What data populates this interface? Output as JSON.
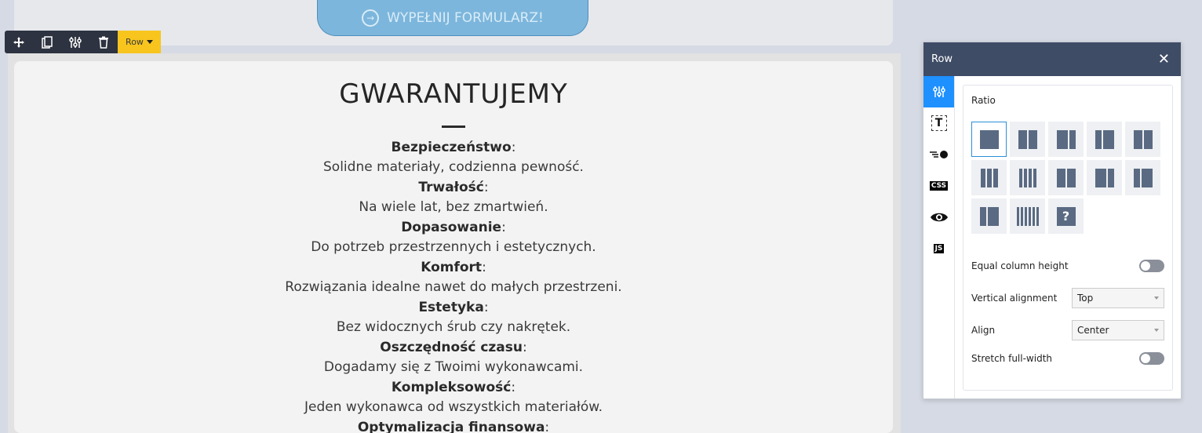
{
  "cta": {
    "label": "WYPEŁNIJ FORMULARZ!",
    "icon": "arrow-circle-right-icon"
  },
  "row_toolbar": {
    "icons": [
      "move-icon",
      "copy-icon",
      "settings-icon",
      "trash-icon"
    ],
    "label": "Row"
  },
  "section": {
    "heading": "GWARANTUJEMY",
    "items": [
      {
        "title": "Bezpieczeństwo",
        "suffix": ":",
        "desc": "Solidne materiały, codzienna pewność."
      },
      {
        "title": "Trwałość",
        "suffix": ":",
        "desc": "Na wiele lat, bez zmartwień."
      },
      {
        "title": "Dopasowanie",
        "suffix": ":",
        "desc": "Do potrzeb przestrzennych i estetycznych."
      },
      {
        "title": "Komfort",
        "suffix": ":",
        "desc": "Rozwiązania idealne nawet do małych przestrzeni."
      },
      {
        "title": "Estetyka",
        "suffix": ":",
        "desc": "Bez widocznych śrub czy nakrętek."
      },
      {
        "title": "Oszczędność czasu",
        "suffix": ":",
        "desc": "Dogadamy się z Twoimi wykonawcami."
      },
      {
        "title": "Kompleksowość",
        "suffix": ":",
        "desc": "Jeden wykonawca od wszystkich materiałów."
      },
      {
        "title": "Optymalizacja finansowa",
        "suffix": ":",
        "desc": ""
      }
    ]
  },
  "panel": {
    "title": "Row",
    "close": "✕",
    "tabs": [
      "sliders-icon",
      "text-icon",
      "animation-icon",
      "css-icon",
      "eye-icon",
      "js-icon"
    ],
    "tab_labels": {
      "css": "CSS",
      "js": "JS",
      "text": "T"
    },
    "ratio_title": "Ratio",
    "settings": {
      "equal_height": "Equal column height",
      "vertical_alignment": "Vertical alignment",
      "vertical_alignment_value": "Top",
      "align": "Align",
      "align_value": "Center",
      "stretch": "Stretch full-width"
    },
    "help_glyph": "?"
  },
  "colors": {
    "panel_header": "#3f4c66",
    "active_tab": "#1e90ff",
    "toolbar_label": "#f7c51e",
    "cta": "#7db6dc"
  }
}
